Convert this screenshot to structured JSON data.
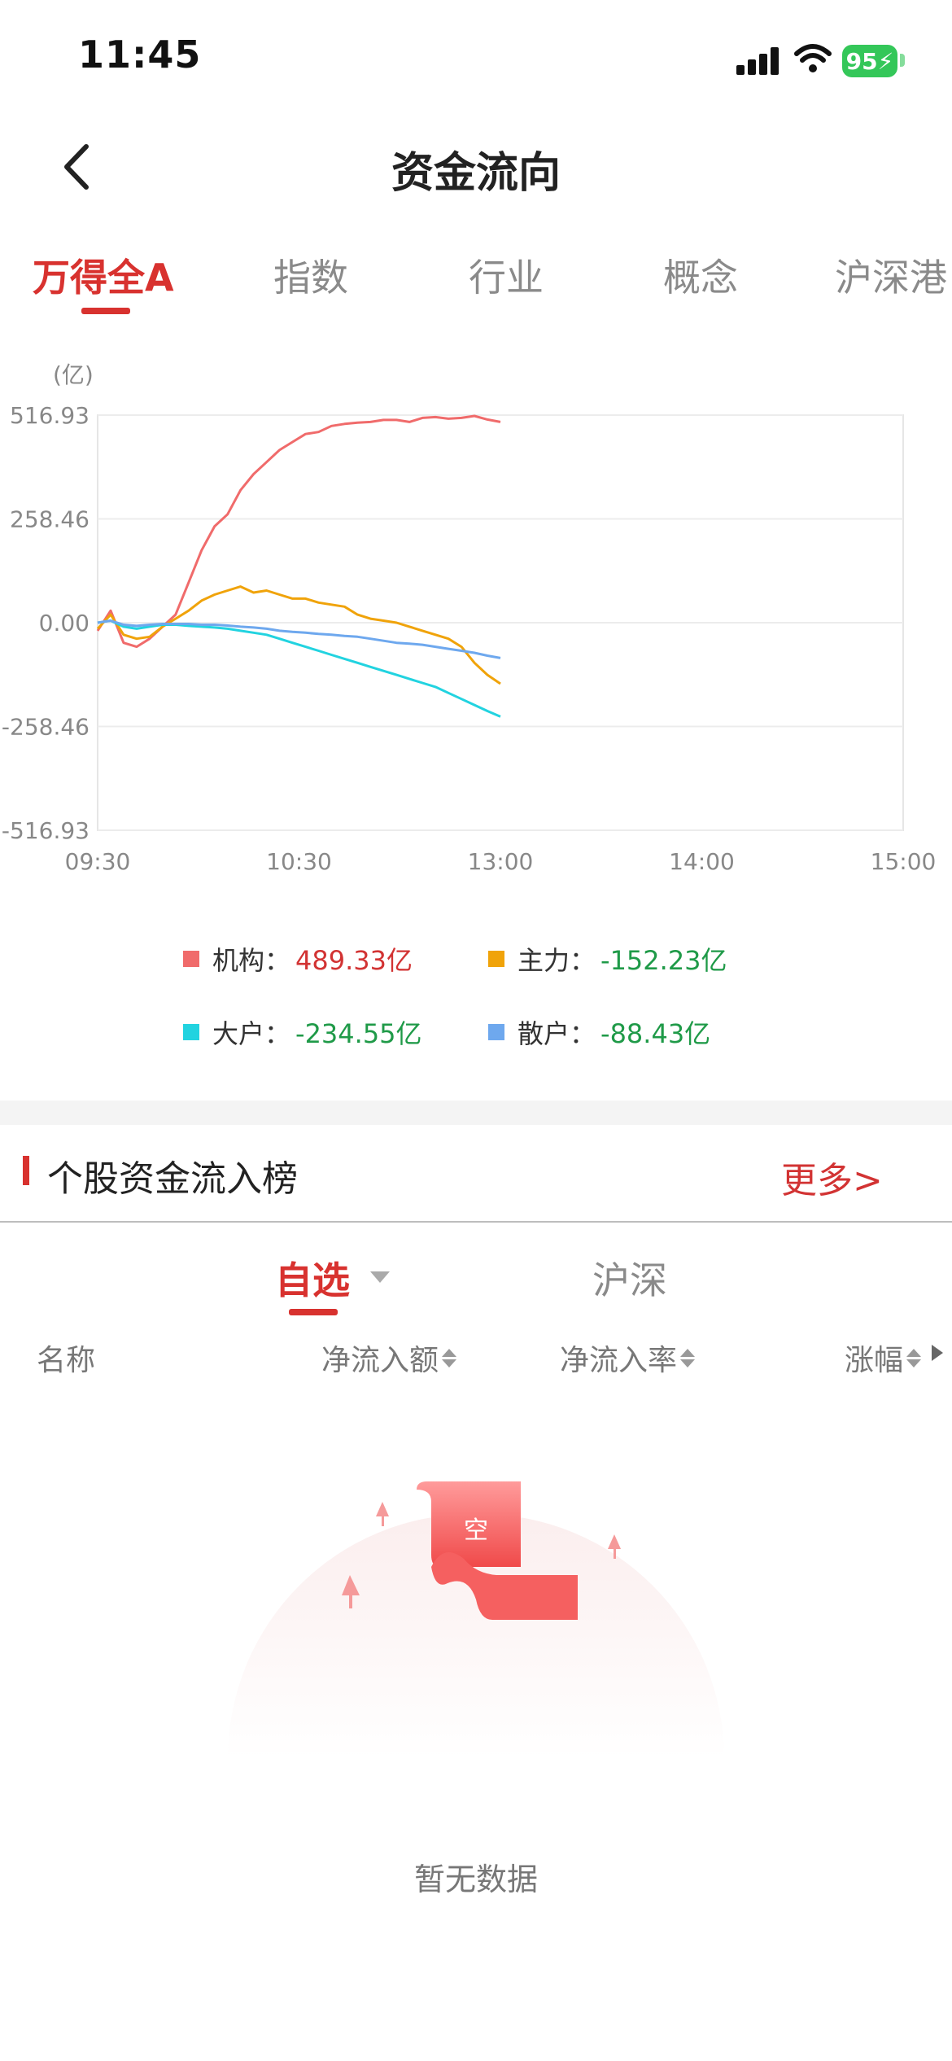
{
  "status_bar": {
    "time": "11:45",
    "battery": "95"
  },
  "nav": {
    "title": "资金流向"
  },
  "tabs": [
    {
      "label": "万得全A",
      "active": true
    },
    {
      "label": "指数",
      "active": false
    },
    {
      "label": "行业",
      "active": false
    },
    {
      "label": "概念",
      "active": false
    },
    {
      "label": "沪深港",
      "active": false
    }
  ],
  "chart_data": {
    "type": "line",
    "unit_label": "(亿)",
    "y_ticks": [
      "516.93",
      "258.46",
      "0.00",
      "-258.46",
      "-516.93"
    ],
    "x_ticks": [
      "09:30",
      "10:30",
      "13:00",
      "14:00",
      "15:00"
    ],
    "ylim": [
      -516.93,
      516.93
    ],
    "grid": true,
    "series": [
      {
        "name": "机构",
        "color": "#f06b6b",
        "values": [
          -20,
          30,
          -50,
          -60,
          -40,
          -10,
          20,
          100,
          180,
          240,
          270,
          330,
          370,
          400,
          430,
          450,
          470,
          475,
          490,
          495,
          498,
          500,
          505,
          505,
          500,
          510,
          512,
          508,
          510,
          515,
          506,
          500
        ]
      },
      {
        "name": "主力",
        "color": "#f0a30a",
        "values": [
          -15,
          20,
          -30,
          -40,
          -35,
          -10,
          10,
          30,
          55,
          70,
          80,
          90,
          75,
          80,
          70,
          60,
          60,
          50,
          45,
          40,
          20,
          10,
          5,
          0,
          -10,
          -20,
          -30,
          -40,
          -60,
          -100,
          -130,
          -152
        ]
      },
      {
        "name": "大户",
        "color": "#22d3e0",
        "values": [
          0,
          5,
          -10,
          -15,
          -10,
          -5,
          -5,
          -8,
          -10,
          -12,
          -15,
          -20,
          -25,
          -30,
          -40,
          -50,
          -60,
          -70,
          -80,
          -90,
          -100,
          -110,
          -120,
          -130,
          -140,
          -150,
          -160,
          -175,
          -190,
          -205,
          -220,
          -234
        ]
      },
      {
        "name": "散户",
        "color": "#6ea8ee",
        "values": [
          0,
          5,
          -5,
          -8,
          -5,
          -3,
          -3,
          -3,
          -5,
          -5,
          -7,
          -10,
          -12,
          -15,
          -20,
          -23,
          -25,
          -28,
          -30,
          -33,
          -35,
          -40,
          -45,
          -50,
          -52,
          -55,
          -60,
          -65,
          -70,
          -75,
          -82,
          -88
        ]
      }
    ]
  },
  "legend": [
    {
      "label": "机构：",
      "value": "489.33亿",
      "color": "#f06b6b",
      "sign": "pos"
    },
    {
      "label": "主力：",
      "value": "-152.23亿",
      "color": "#f0a30a",
      "sign": "neg"
    },
    {
      "label": "大户：",
      "value": "-234.55亿",
      "color": "#22d3e0",
      "sign": "neg"
    },
    {
      "label": "散户：",
      "value": "-88.43亿",
      "color": "#6ea8ee",
      "sign": "neg"
    }
  ],
  "section": {
    "title": "个股资金流入榜",
    "more": "更多>"
  },
  "sub_tabs": {
    "first": "自选",
    "second": "沪深"
  },
  "columns": {
    "name": "名称",
    "net_inflow": "净流入额",
    "net_rate": "净流入率",
    "change": "涨幅"
  },
  "empty": {
    "badge": "空",
    "message": "暂无数据"
  },
  "colors": {
    "accent": "#d8322f",
    "positive": "#d23333",
    "negative": "#1f9a48"
  }
}
